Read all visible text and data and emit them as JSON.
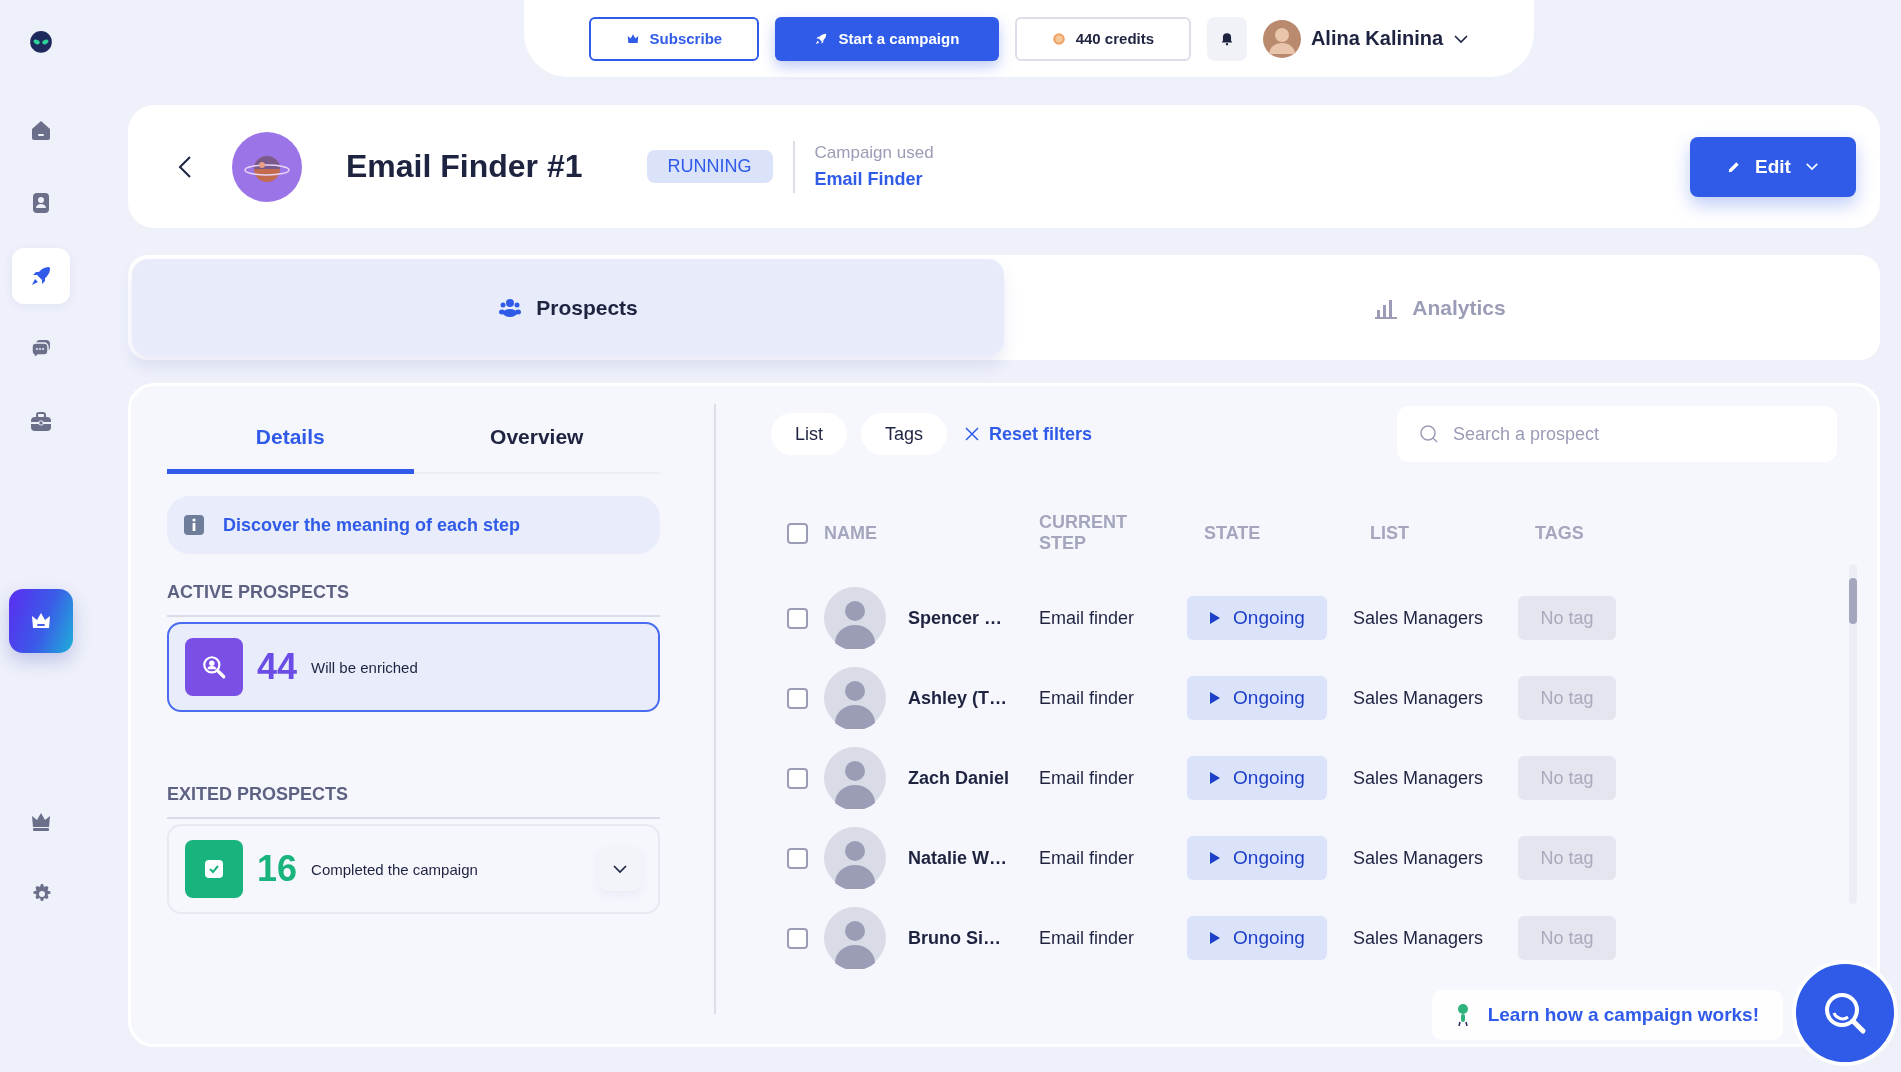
{
  "sidebar": {
    "items": [
      {
        "selected": false
      },
      {
        "selected": false
      },
      {
        "selected": true
      },
      {
        "selected": false
      },
      {
        "selected": false
      },
      {
        "selected": false
      },
      {
        "selected": false
      }
    ]
  },
  "topbar": {
    "subscribe": "Subscribe",
    "start_campaign": "Start a campaign",
    "credits": "440 credits",
    "user_name": "Alina Kalinina"
  },
  "header": {
    "title": "Email Finder #1",
    "status": "RUNNING",
    "campaign_label": "Campaign used",
    "campaign_link": "Email Finder",
    "edit": "Edit"
  },
  "tabs": [
    {
      "label": "Prospects",
      "selected": true
    },
    {
      "label": "Analytics",
      "selected": false
    }
  ],
  "details_tabs": [
    {
      "label": "Details",
      "selected": true
    },
    {
      "label": "Overview",
      "selected": false
    }
  ],
  "info_banner": "Discover the meaning of each step",
  "prospect_groups": [
    {
      "kind": "active",
      "heading": "ACTIVE PROSPECTS",
      "count": "44",
      "label": "Will be enriched"
    },
    {
      "kind": "exited",
      "heading": "EXITED PROSPECTS",
      "count": "16",
      "label": "Completed the campaign"
    }
  ],
  "filters": [
    {
      "label": "List"
    },
    {
      "label": "Tags"
    }
  ],
  "reset_filters": "Reset filters",
  "search": {
    "placeholder": "Search a prospect"
  },
  "table": {
    "select_all_checked": false,
    "columns": [
      "NAME",
      "CURRENT STEP",
      "STATE",
      "LIST",
      "TAGS"
    ],
    "rows": [
      {
        "checked": false,
        "name": "Spencer …",
        "current_step": "Email finder",
        "state": "Ongoing",
        "list": "Sales Managers",
        "tags": "No tag"
      },
      {
        "checked": false,
        "name": "Ashley (T…",
        "current_step": "Email finder",
        "state": "Ongoing",
        "list": "Sales Managers",
        "tags": "No tag"
      },
      {
        "checked": false,
        "name": "Zach Daniel",
        "current_step": "Email finder",
        "state": "Ongoing",
        "list": "Sales Managers",
        "tags": "No tag"
      },
      {
        "checked": false,
        "name": "Natalie W…",
        "current_step": "Email finder",
        "state": "Ongoing",
        "list": "Sales Managers",
        "tags": "No tag"
      },
      {
        "checked": false,
        "name": "Bruno Si…",
        "current_step": "Email finder",
        "state": "Ongoing",
        "list": "Sales Managers",
        "tags": "No tag"
      }
    ]
  },
  "help_toast": "Learn how a campaign works!"
}
